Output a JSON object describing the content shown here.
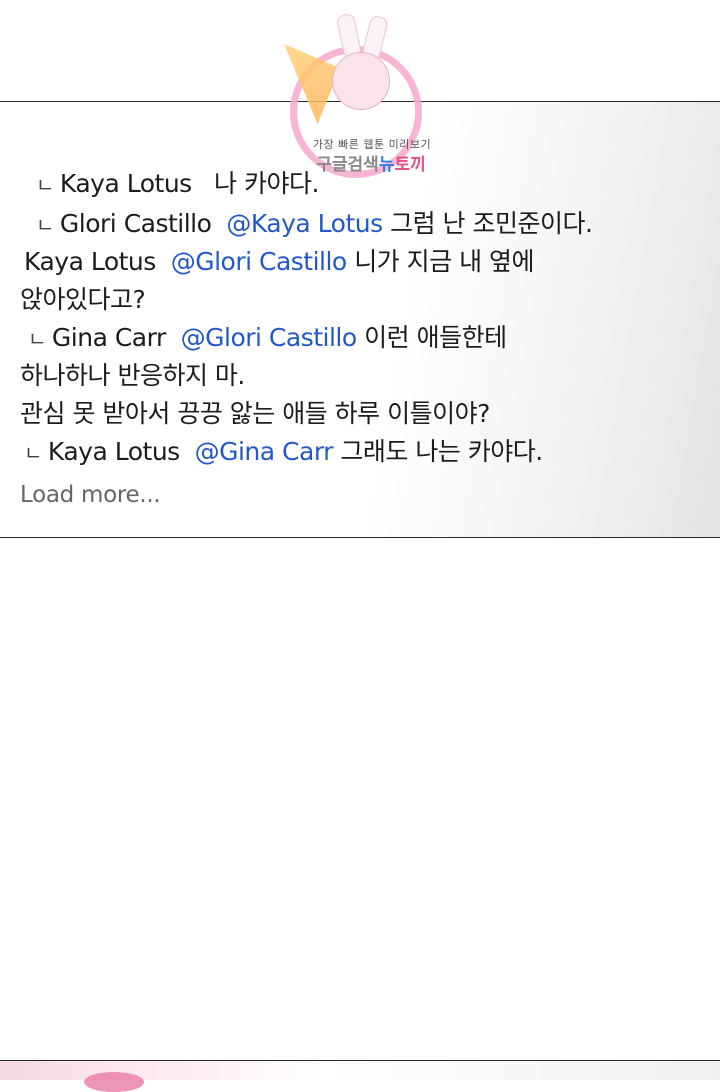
{
  "watermark": {
    "tagline": "가장 빠른 웹툰 미리보기",
    "brand_part1": "구글검색",
    "brand_part2": "뉴",
    "brand_part3": "토끼"
  },
  "reply_marker": "ㄴ",
  "comments": [
    {
      "reply": true,
      "author": "Kaya Lotus",
      "mention": "",
      "text": "나 카야다."
    },
    {
      "reply": true,
      "author": "Glori Castillo",
      "mention": "@Kaya Lotus",
      "text": "그럼 난 조민준이다."
    },
    {
      "reply": false,
      "author": "Kaya Lotus",
      "mention": "@Glori Castillo",
      "text": "니가 지금 내 옆에",
      "text_cont": "앉아있다고?"
    },
    {
      "reply": true,
      "author": "Gina Carr",
      "mention": "@Glori Castillo",
      "text": "이런 애들한테",
      "text_cont": "하나하나 반응하지 마.",
      "text_cont2": "관심 못 받아서 끙끙 앓는 애들 하루 이틀이야?"
    },
    {
      "reply": true,
      "author": "Kaya Lotus",
      "mention": "@Gina Carr",
      "text": "그래도 나는 카야다."
    }
  ],
  "load_more": "Load more..."
}
